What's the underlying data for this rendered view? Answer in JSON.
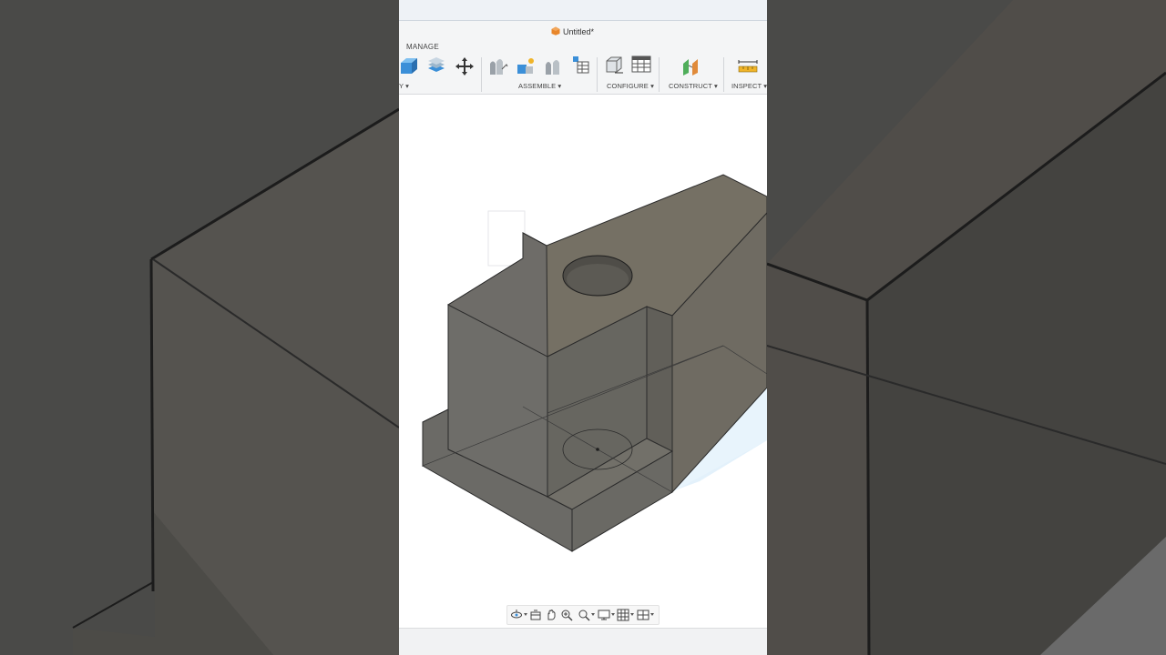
{
  "window": {
    "title": "Untitled*"
  },
  "toolbar": {
    "active_tab": "MANAGE",
    "groups": [
      {
        "label": "Y"
      },
      {
        "label": "ASSEMBLE"
      },
      {
        "label": "CONFIGURE"
      },
      {
        "label": "CONSTRUCT"
      },
      {
        "label": "INSPECT"
      }
    ]
  },
  "colors": {
    "model_face_top": "#757064",
    "model_face_front": "#6d6b66",
    "model_face_side": "#66635b",
    "edge": "#2b2b2b",
    "accent_blue": "#3b8fd8",
    "title_icon": "#e8862a"
  },
  "icons": {
    "title": "design-file-icon",
    "nav": [
      "orbit-icon",
      "look-at-icon",
      "pan-icon",
      "zoom-window-icon",
      "zoom-icon",
      "display-settings-icon",
      "grid-settings-icon",
      "viewports-icon"
    ]
  }
}
